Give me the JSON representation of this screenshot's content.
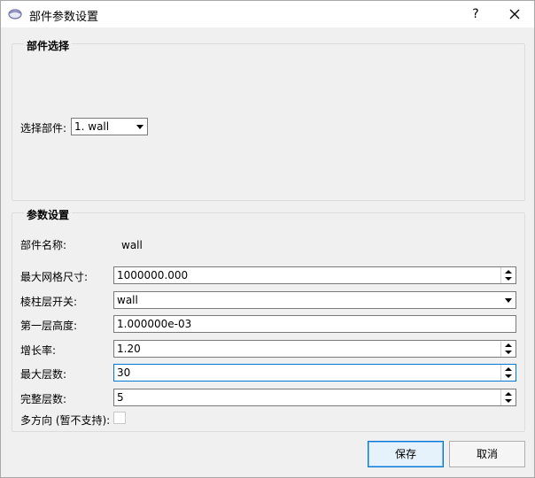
{
  "window": {
    "title": "部件参数设置",
    "help_label": "?"
  },
  "part_select_group": {
    "title": "部件选择",
    "select_label": "选择部件:",
    "selected_part": "1. wall"
  },
  "params_group": {
    "title": "参数设置",
    "part_name_label": "部件名称:",
    "part_name_value": "wall",
    "max_mesh_size_label": "最大网格尺寸:",
    "max_mesh_size_value": "1000000.000",
    "prism_layer_switch_label": "棱柱层开关:",
    "prism_layer_switch_value": "wall",
    "first_layer_height_label": "第一层高度:",
    "first_layer_height_value": "1.000000e-03",
    "growth_rate_label": "增长率:",
    "growth_rate_value": "1.20",
    "max_layers_label": "最大层数:",
    "max_layers_value": "30",
    "full_layers_label": "完整层数:",
    "full_layers_value": "5",
    "multi_direction_label": "多方向 (暂不支持):",
    "multi_direction_checked": false
  },
  "buttons": {
    "save": "保存",
    "cancel": "取消"
  }
}
